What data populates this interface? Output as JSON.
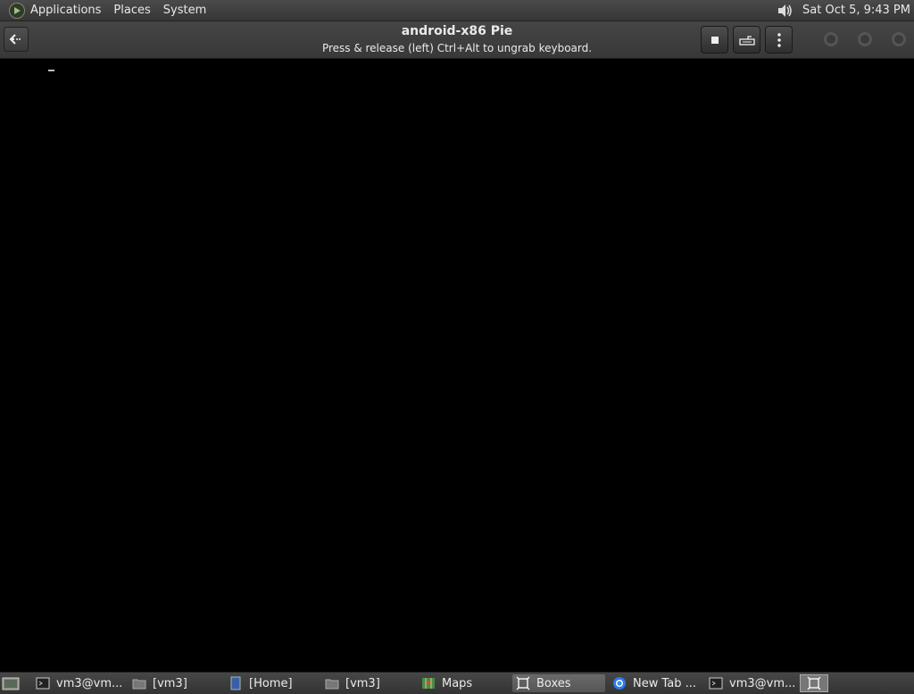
{
  "top_panel": {
    "menus": [
      "Applications",
      "Places",
      "System"
    ],
    "clock": "Sat Oct  5,  9:43 PM"
  },
  "headerbar": {
    "title": "android-x86 Pie",
    "subtitle": "Press & release (left) Ctrl+Alt to ungrab keyboard."
  },
  "taskbar": {
    "tasks": [
      {
        "label": "vm3@vm...",
        "icon": "terminal-icon"
      },
      {
        "label": "[vm3]",
        "icon": "folder-icon"
      },
      {
        "label": "[Home]",
        "icon": "notebook-icon"
      },
      {
        "label": "[vm3]",
        "icon": "folder-icon"
      },
      {
        "label": "Maps",
        "icon": "map-icon"
      },
      {
        "label": "Boxes",
        "icon": "boxes-icon",
        "active": true
      },
      {
        "label": "New Tab ...",
        "icon": "chrome-icon"
      },
      {
        "label": "vm3@vm...",
        "icon": "terminal-icon"
      }
    ]
  }
}
